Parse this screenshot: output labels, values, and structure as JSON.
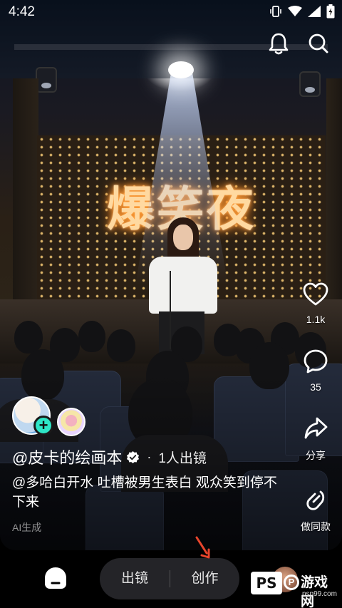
{
  "status_bar": {
    "time": "4:42"
  },
  "stage": {
    "marquee_text": "爆笑夜"
  },
  "actions": {
    "notifications": "bell-icon",
    "search": "search-icon"
  },
  "rail": {
    "like_count": "1.1k",
    "comment_count": "35",
    "share_label": "分享",
    "remix_label": "做同款"
  },
  "author": {
    "name": "@皮卡的绘画本",
    "dot": "·",
    "collab": "1人出镜"
  },
  "caption": {
    "text": "@多哈白开水 吐槽被男生表白 观众笑到停不下来",
    "ai_tag": "AI生成"
  },
  "bottom_nav": {
    "left_label": "出镜",
    "right_label": "创作"
  },
  "watermark": {
    "logo": "PS",
    "p": "P",
    "name": "游戏网",
    "url": "psp99.com"
  },
  "colors": {
    "follow": "#2ee6c7",
    "pill_bg": "#242428",
    "arrow": "#e8452c"
  }
}
